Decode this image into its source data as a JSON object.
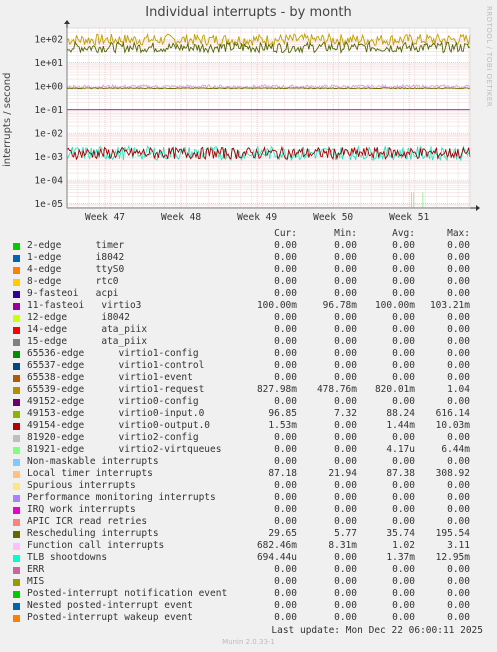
{
  "title": "Individual interrupts - by month",
  "side_label": "RRDTOOL / TOBI OETIKER",
  "y_axis_label": "interrupts / second",
  "columns": [
    "Cur:",
    "Min:",
    "Avg:",
    "Max:"
  ],
  "footer": "Last update:  Mon Dec 22 06:00:11 2025",
  "munin": "Munin 2.0.33-1",
  "chart_data": {
    "type": "line",
    "title": "Individual interrupts - by month",
    "ylabel": "interrupts / second",
    "yscale": "log",
    "ylim": [
      6.5e-06,
      300
    ],
    "y_ticks": [
      {
        "value": 100,
        "label": "1e+02"
      },
      {
        "value": 10,
        "label": "1e+01"
      },
      {
        "value": 1,
        "label": "1e+00"
      },
      {
        "value": 0.1,
        "label": "1e-01"
      },
      {
        "value": 0.01,
        "label": "1e-02"
      },
      {
        "value": 0.001,
        "label": "1e-03"
      },
      {
        "value": 0.0001,
        "label": "1e-04"
      },
      {
        "value": 1e-05,
        "label": "1e-05"
      }
    ],
    "x_domain_weeks": [
      46.5,
      51.8
    ],
    "x_ticks": [
      {
        "value": 47,
        "label": "Week 47"
      },
      {
        "value": 48,
        "label": "Week 48"
      },
      {
        "value": 49,
        "label": "Week 49"
      },
      {
        "value": 50,
        "label": "Week 50"
      },
      {
        "value": 51,
        "label": "Week 51"
      }
    ],
    "grid": true,
    "series_lines": [
      {
        "name": "Rescheduling interrupts",
        "color": "#c0a000",
        "base": 95,
        "noise": 0.25
      },
      {
        "name": "Local timer interrupts",
        "color": "#4d6600",
        "base": 45,
        "noise": 0.22
      },
      {
        "name": "Function call interrupts",
        "color": "#e0a0e0",
        "base": 0.95,
        "noise": 0.08
      },
      {
        "name": "65539-edge      virtio1-request",
        "color": "#707000",
        "base": 0.82,
        "noise": 0.02
      },
      {
        "name": "11-fasteoi   virtio3",
        "color": "#8020a0",
        "base": 0.1,
        "noise": 0.0
      },
      {
        "name": "TLB shootdowns",
        "color": "#30e0c0",
        "base": 0.0014,
        "noise": 0.3
      },
      {
        "name": "49154-edge      virtio0-output.0",
        "color": "#a00000",
        "base": 0.0014,
        "noise": 0.25
      },
      {
        "name": "81921-edge      virtio2-virtqueues",
        "color": "#90f090",
        "base": 6e-06,
        "noise": 0.0
      }
    ],
    "legend_entries": [
      {
        "name": "2-edge      timer",
        "color": "#00cc00",
        "cur": "0.00",
        "min": "0.00",
        "avg": "0.00",
        "max": "0.00"
      },
      {
        "name": "1-edge      i8042",
        "color": "#0066b3",
        "cur": "0.00",
        "min": "0.00",
        "avg": "0.00",
        "max": "0.00"
      },
      {
        "name": "4-edge      ttyS0",
        "color": "#ff8000",
        "cur": "0.00",
        "min": "0.00",
        "avg": "0.00",
        "max": "0.00"
      },
      {
        "name": "8-edge      rtc0",
        "color": "#ffcc00",
        "cur": "0.00",
        "min": "0.00",
        "avg": "0.00",
        "max": "0.00"
      },
      {
        "name": "9-fasteoi   acpi",
        "color": "#330099",
        "cur": "0.00",
        "min": "0.00",
        "avg": "0.00",
        "max": "0.00"
      },
      {
        "name": "11-fasteoi   virtio3",
        "color": "#990099",
        "cur": "100.00m",
        "min": "96.78m",
        "avg": "100.00m",
        "max": "103.21m"
      },
      {
        "name": "12-edge      i8042",
        "color": "#ccff00",
        "cur": "0.00",
        "min": "0.00",
        "avg": "0.00",
        "max": "0.00"
      },
      {
        "name": "14-edge      ata_piix",
        "color": "#ff0000",
        "cur": "0.00",
        "min": "0.00",
        "avg": "0.00",
        "max": "0.00"
      },
      {
        "name": "15-edge      ata_piix",
        "color": "#808080",
        "cur": "0.00",
        "min": "0.00",
        "avg": "0.00",
        "max": "0.00"
      },
      {
        "name": "65536-edge      virtio1-config",
        "color": "#008f00",
        "cur": "0.00",
        "min": "0.00",
        "avg": "0.00",
        "max": "0.00"
      },
      {
        "name": "65537-edge      virtio1-control",
        "color": "#00487d",
        "cur": "0.00",
        "min": "0.00",
        "avg": "0.00",
        "max": "0.00"
      },
      {
        "name": "65538-edge      virtio1-event",
        "color": "#b35a00",
        "cur": "0.00",
        "min": "0.00",
        "avg": "0.00",
        "max": "0.00"
      },
      {
        "name": "65539-edge      virtio1-request",
        "color": "#b38f00",
        "cur": "827.98m",
        "min": "478.76m",
        "avg": "820.01m",
        "max": "1.04"
      },
      {
        "name": "49152-edge      virtio0-config",
        "color": "#6b006b",
        "cur": "0.00",
        "min": "0.00",
        "avg": "0.00",
        "max": "0.00"
      },
      {
        "name": "49153-edge      virtio0-input.0",
        "color": "#8fb300",
        "cur": "96.85",
        "min": "7.32",
        "avg": "88.24",
        "max": "616.14"
      },
      {
        "name": "49154-edge      virtio0-output.0",
        "color": "#b30000",
        "cur": "1.53m",
        "min": "0.00",
        "avg": "1.44m",
        "max": "10.03m"
      },
      {
        "name": "81920-edge      virtio2-config",
        "color": "#bebebe",
        "cur": "0.00",
        "min": "0.00",
        "avg": "0.00",
        "max": "0.00"
      },
      {
        "name": "81921-edge      virtio2-virtqueues",
        "color": "#80ff80",
        "cur": "0.00",
        "min": "0.00",
        "avg": "4.17u",
        "max": "6.44m"
      },
      {
        "name": "Non-maskable interrupts",
        "color": "#80c9ff",
        "cur": "0.00",
        "min": "0.00",
        "avg": "0.00",
        "max": "0.00"
      },
      {
        "name": "Local timer interrupts",
        "color": "#ffc080",
        "cur": "87.18",
        "min": "21.94",
        "avg": "87.38",
        "max": "308.92"
      },
      {
        "name": "Spurious interrupts",
        "color": "#ffe680",
        "cur": "0.00",
        "min": "0.00",
        "avg": "0.00",
        "max": "0.00"
      },
      {
        "name": "Performance monitoring interrupts",
        "color": "#aa80ff",
        "cur": "0.00",
        "min": "0.00",
        "avg": "0.00",
        "max": "0.00"
      },
      {
        "name": "IRQ work interrupts",
        "color": "#ee00cc",
        "cur": "0.00",
        "min": "0.00",
        "avg": "0.00",
        "max": "0.00"
      },
      {
        "name": "APIC ICR read retries",
        "color": "#ff8080",
        "cur": "0.00",
        "min": "0.00",
        "avg": "0.00",
        "max": "0.00"
      },
      {
        "name": "Rescheduling interrupts",
        "color": "#666600",
        "cur": "29.65",
        "min": "5.77",
        "avg": "35.74",
        "max": "195.54"
      },
      {
        "name": "Function call interrupts",
        "color": "#ffbfff",
        "cur": "682.46m",
        "min": "8.31m",
        "avg": "1.02",
        "max": "3.11"
      },
      {
        "name": "TLB shootdowns",
        "color": "#00ffcc",
        "cur": "694.44u",
        "min": "0.00",
        "avg": "1.37m",
        "max": "12.95m"
      },
      {
        "name": "ERR",
        "color": "#cc6699",
        "cur": "0.00",
        "min": "0.00",
        "avg": "0.00",
        "max": "0.00"
      },
      {
        "name": "MIS",
        "color": "#999900",
        "cur": "0.00",
        "min": "0.00",
        "avg": "0.00",
        "max": "0.00"
      },
      {
        "name": "Posted-interrupt notification event",
        "color": "#00cc00",
        "cur": "0.00",
        "min": "0.00",
        "avg": "0.00",
        "max": "0.00"
      },
      {
        "name": "Nested posted-interrupt event",
        "color": "#0066b3",
        "cur": "0.00",
        "min": "0.00",
        "avg": "0.00",
        "max": "0.00"
      },
      {
        "name": "Posted-interrupt wakeup event",
        "color": "#ff8000",
        "cur": "0.00",
        "min": "0.00",
        "avg": "0.00",
        "max": "0.00"
      }
    ]
  }
}
